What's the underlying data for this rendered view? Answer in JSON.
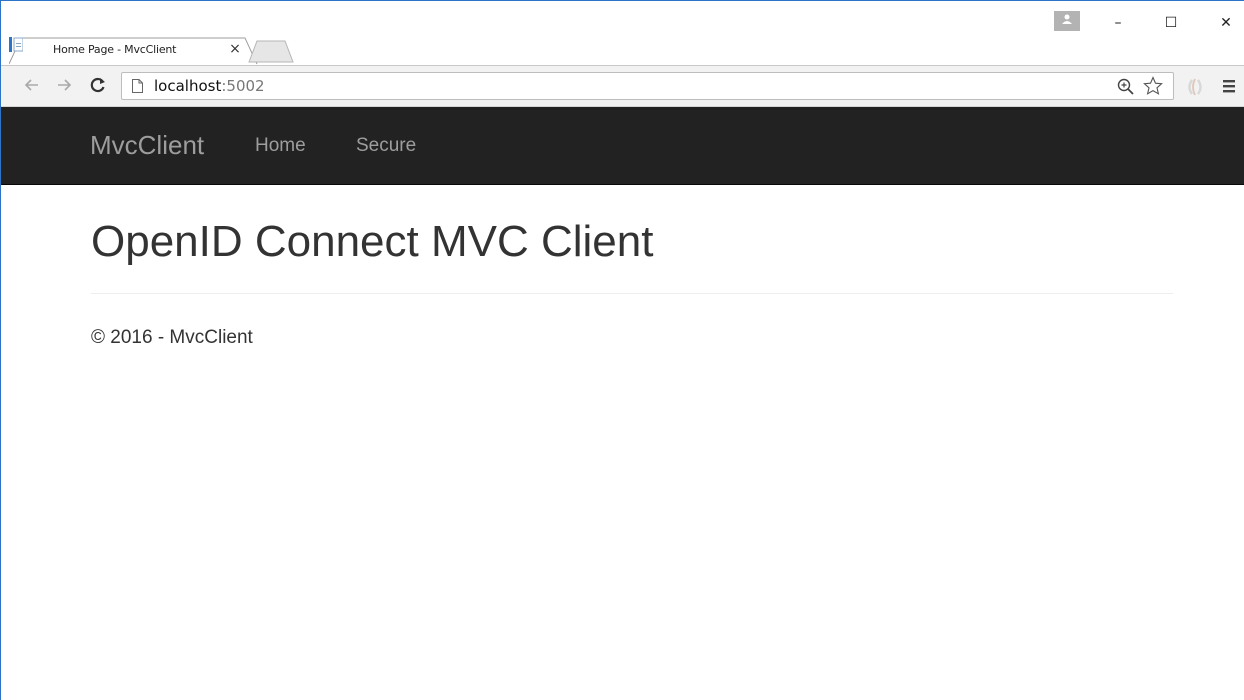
{
  "browser": {
    "tab_title": "Home Page - MvcClient",
    "tab_close_glyph": "×",
    "url_host": "localhost",
    "url_port": ":5002",
    "icons": {
      "back": "arrow-left-icon",
      "forward": "arrow-right-icon",
      "reload": "reload-icon",
      "page": "page-icon",
      "zoom": "zoom-icon",
      "bookmark": "star-icon",
      "extension": "extension-icon",
      "menu": "hamburger-menu-icon",
      "profile": "profile-icon"
    },
    "window_controls": {
      "minimize": "–",
      "maximize": "☐",
      "close": "✕"
    },
    "accent_color": "#2b74c7"
  },
  "site": {
    "brand": "MvcClient",
    "nav": [
      {
        "label": "Home"
      },
      {
        "label": "Secure"
      }
    ],
    "navbar_color": "#222222"
  },
  "main": {
    "title": "OpenID Connect MVC Client"
  },
  "footer": {
    "text": "© 2016 - MvcClient"
  }
}
